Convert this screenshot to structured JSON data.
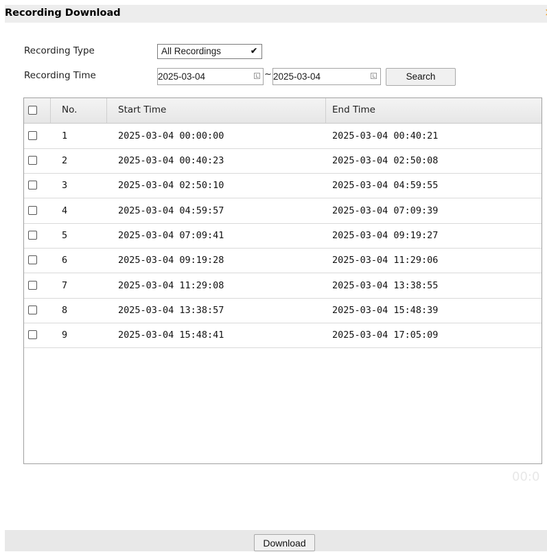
{
  "dialog": {
    "title": "Recording Download",
    "close_glyph": "×"
  },
  "filters": {
    "type_label": "Recording Type",
    "type_value": "All Recordings",
    "time_label": "Recording Time",
    "start_date": "2025-03-04",
    "separator": "~",
    "end_date": "2025-03-04",
    "search_label": "Search"
  },
  "table": {
    "columns": [
      "No.",
      "Start Time",
      "End Time"
    ],
    "rows": [
      {
        "no": "1",
        "start": "2025-03-04 00:00:00",
        "end": "2025-03-04 00:40:21"
      },
      {
        "no": "2",
        "start": "2025-03-04 00:40:23",
        "end": "2025-03-04 02:50:08"
      },
      {
        "no": "3",
        "start": "2025-03-04 02:50:10",
        "end": "2025-03-04 04:59:55"
      },
      {
        "no": "4",
        "start": "2025-03-04 04:59:57",
        "end": "2025-03-04 07:09:39"
      },
      {
        "no": "5",
        "start": "2025-03-04 07:09:41",
        "end": "2025-03-04 09:19:27"
      },
      {
        "no": "6",
        "start": "2025-03-04 09:19:28",
        "end": "2025-03-04 11:29:06"
      },
      {
        "no": "7",
        "start": "2025-03-04 11:29:08",
        "end": "2025-03-04 13:38:55"
      },
      {
        "no": "8",
        "start": "2025-03-04 13:38:57",
        "end": "2025-03-04 15:48:39"
      },
      {
        "no": "9",
        "start": "2025-03-04 15:48:41",
        "end": "2025-03-04 17:05:09"
      }
    ]
  },
  "background_time": "00:0",
  "footer": {
    "download_label": "Download"
  },
  "colors": {
    "close_icon": "#f0a030",
    "title_bar": "#ededed",
    "footer_bar": "#e8e8e8"
  }
}
